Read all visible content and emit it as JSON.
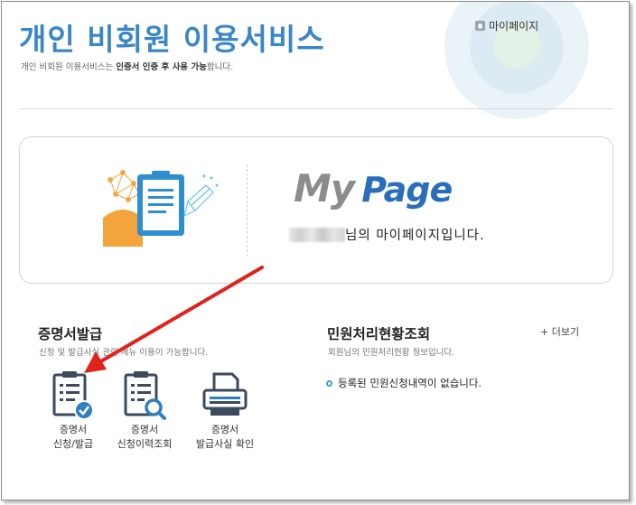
{
  "header": {
    "title": "개인 비회원 이용서비스",
    "desc_pre": "개인 비회원 이용서비스는 ",
    "desc_bold": "인증서 인증 후 사용 가능",
    "desc_post": "합니다.",
    "mypage_link": "마이페이지"
  },
  "banner": {
    "logo_my": "My",
    "logo_page": "Page",
    "subtitle_suffix": "님의 마이페이지입니다."
  },
  "certificate": {
    "title": "증명서발급",
    "desc": "신청 및 발급사실 관련 메뉴 이용이 가능합니다.",
    "services": [
      {
        "line1": "증명서",
        "line2": "신청/발급"
      },
      {
        "line1": "증명서",
        "line2": "신청이력조회"
      },
      {
        "line1": "증명서",
        "line2": "발급사실 확인"
      }
    ]
  },
  "civil": {
    "title": "민원처리현황조회",
    "desc": "회원님의 민원처리현황 정보입니다.",
    "more": "+ 더보기",
    "empty_message": "등록된 민원신청내역이 없습니다."
  },
  "colors": {
    "title_blue": "#3a86c6",
    "logo_blue": "#2a6ebb",
    "icon_navy": "#3b4a5c",
    "accent_blue": "#2f7fc1",
    "arrow_red": "#e0221b"
  }
}
